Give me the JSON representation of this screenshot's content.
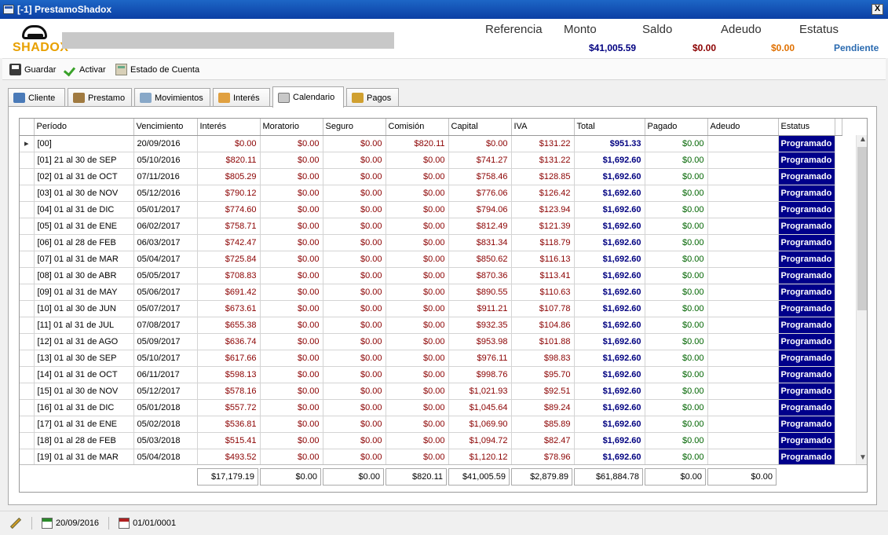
{
  "window": {
    "title": "[-1] PrestamoShadox",
    "close": "X"
  },
  "brand": {
    "logo_text": "SHADOX"
  },
  "summary": {
    "labels": {
      "referencia": "Referencia",
      "monto": "Monto",
      "saldo": "Saldo",
      "adeudo": "Adeudo",
      "estatus": "Estatus"
    },
    "values": {
      "monto": "$41,005.59",
      "saldo": "$0.00",
      "adeudo": "$0.00",
      "estatus": "Pendiente"
    }
  },
  "toolbar": {
    "guardar": "Guardar",
    "activar": "Activar",
    "estado": "Estado de Cuenta"
  },
  "tabs": [
    "Cliente",
    "Prestamo",
    "Movimientos",
    "Interés",
    "Calendario",
    "Pagos"
  ],
  "active_tab": "Calendario",
  "grid": {
    "columns": [
      "Período",
      "Vencimiento",
      "Interés",
      "Moratorio",
      "Seguro",
      "Comisión",
      "Capital",
      "IVA",
      "Total",
      "Pagado",
      "Adeudo",
      "Estatus"
    ],
    "rows": [
      [
        "[00]",
        "20/09/2016",
        "$0.00",
        "$0.00",
        "$0.00",
        "$820.11",
        "$0.00",
        "$131.22",
        "$951.33",
        "$0.00",
        "",
        "Programado"
      ],
      [
        "[01] 21 al 30 de SEP",
        "05/10/2016",
        "$820.11",
        "$0.00",
        "$0.00",
        "$0.00",
        "$741.27",
        "$131.22",
        "$1,692.60",
        "$0.00",
        "",
        "Programado"
      ],
      [
        "[02] 01 al 31 de OCT",
        "07/11/2016",
        "$805.29",
        "$0.00",
        "$0.00",
        "$0.00",
        "$758.46",
        "$128.85",
        "$1,692.60",
        "$0.00",
        "",
        "Programado"
      ],
      [
        "[03] 01 al 30 de NOV",
        "05/12/2016",
        "$790.12",
        "$0.00",
        "$0.00",
        "$0.00",
        "$776.06",
        "$126.42",
        "$1,692.60",
        "$0.00",
        "",
        "Programado"
      ],
      [
        "[04] 01 al 31 de DIC",
        "05/01/2017",
        "$774.60",
        "$0.00",
        "$0.00",
        "$0.00",
        "$794.06",
        "$123.94",
        "$1,692.60",
        "$0.00",
        "",
        "Programado"
      ],
      [
        "[05] 01 al 31 de ENE",
        "06/02/2017",
        "$758.71",
        "$0.00",
        "$0.00",
        "$0.00",
        "$812.49",
        "$121.39",
        "$1,692.60",
        "$0.00",
        "",
        "Programado"
      ],
      [
        "[06] 01 al 28 de FEB",
        "06/03/2017",
        "$742.47",
        "$0.00",
        "$0.00",
        "$0.00",
        "$831.34",
        "$118.79",
        "$1,692.60",
        "$0.00",
        "",
        "Programado"
      ],
      [
        "[07] 01 al 31 de MAR",
        "05/04/2017",
        "$725.84",
        "$0.00",
        "$0.00",
        "$0.00",
        "$850.62",
        "$116.13",
        "$1,692.60",
        "$0.00",
        "",
        "Programado"
      ],
      [
        "[08] 01 al 30 de ABR",
        "05/05/2017",
        "$708.83",
        "$0.00",
        "$0.00",
        "$0.00",
        "$870.36",
        "$113.41",
        "$1,692.60",
        "$0.00",
        "",
        "Programado"
      ],
      [
        "[09] 01 al 31 de MAY",
        "05/06/2017",
        "$691.42",
        "$0.00",
        "$0.00",
        "$0.00",
        "$890.55",
        "$110.63",
        "$1,692.60",
        "$0.00",
        "",
        "Programado"
      ],
      [
        "[10] 01 al 30 de JUN",
        "05/07/2017",
        "$673.61",
        "$0.00",
        "$0.00",
        "$0.00",
        "$911.21",
        "$107.78",
        "$1,692.60",
        "$0.00",
        "",
        "Programado"
      ],
      [
        "[11] 01 al 31 de JUL",
        "07/08/2017",
        "$655.38",
        "$0.00",
        "$0.00",
        "$0.00",
        "$932.35",
        "$104.86",
        "$1,692.60",
        "$0.00",
        "",
        "Programado"
      ],
      [
        "[12] 01 al 31 de AGO",
        "05/09/2017",
        "$636.74",
        "$0.00",
        "$0.00",
        "$0.00",
        "$953.98",
        "$101.88",
        "$1,692.60",
        "$0.00",
        "",
        "Programado"
      ],
      [
        "[13] 01 al 30 de SEP",
        "05/10/2017",
        "$617.66",
        "$0.00",
        "$0.00",
        "$0.00",
        "$976.11",
        "$98.83",
        "$1,692.60",
        "$0.00",
        "",
        "Programado"
      ],
      [
        "[14] 01 al 31 de OCT",
        "06/11/2017",
        "$598.13",
        "$0.00",
        "$0.00",
        "$0.00",
        "$998.76",
        "$95.70",
        "$1,692.60",
        "$0.00",
        "",
        "Programado"
      ],
      [
        "[15] 01 al 30 de NOV",
        "05/12/2017",
        "$578.16",
        "$0.00",
        "$0.00",
        "$0.00",
        "$1,021.93",
        "$92.51",
        "$1,692.60",
        "$0.00",
        "",
        "Programado"
      ],
      [
        "[16] 01 al 31 de DIC",
        "05/01/2018",
        "$557.72",
        "$0.00",
        "$0.00",
        "$0.00",
        "$1,045.64",
        "$89.24",
        "$1,692.60",
        "$0.00",
        "",
        "Programado"
      ],
      [
        "[17] 01 al 31 de ENE",
        "05/02/2018",
        "$536.81",
        "$0.00",
        "$0.00",
        "$0.00",
        "$1,069.90",
        "$85.89",
        "$1,692.60",
        "$0.00",
        "",
        "Programado"
      ],
      [
        "[18] 01 al 28 de FEB",
        "05/03/2018",
        "$515.41",
        "$0.00",
        "$0.00",
        "$0.00",
        "$1,094.72",
        "$82.47",
        "$1,692.60",
        "$0.00",
        "",
        "Programado"
      ],
      [
        "[19] 01 al 31 de MAR",
        "05/04/2018",
        "$493.52",
        "$0.00",
        "$0.00",
        "$0.00",
        "$1,120.12",
        "$78.96",
        "$1,692.60",
        "$0.00",
        "",
        "Programado"
      ]
    ],
    "totals": [
      "$17,179.19",
      "$0.00",
      "$0.00",
      "$820.11",
      "$41,005.59",
      "$2,879.89",
      "$61,884.78",
      "$0.00",
      "$0.00"
    ]
  },
  "statusbar": {
    "date1": "20/09/2016",
    "date2": "01/01/0001"
  },
  "colors": {
    "accent": "#00008b",
    "red": "#8b0000",
    "green": "#006400",
    "orange": "#e07000",
    "pendiente": "#2a6ab0"
  },
  "icons": [
    "save-icon",
    "check-icon",
    "calculator-icon",
    "pencil-icon",
    "calendar-icon"
  ]
}
